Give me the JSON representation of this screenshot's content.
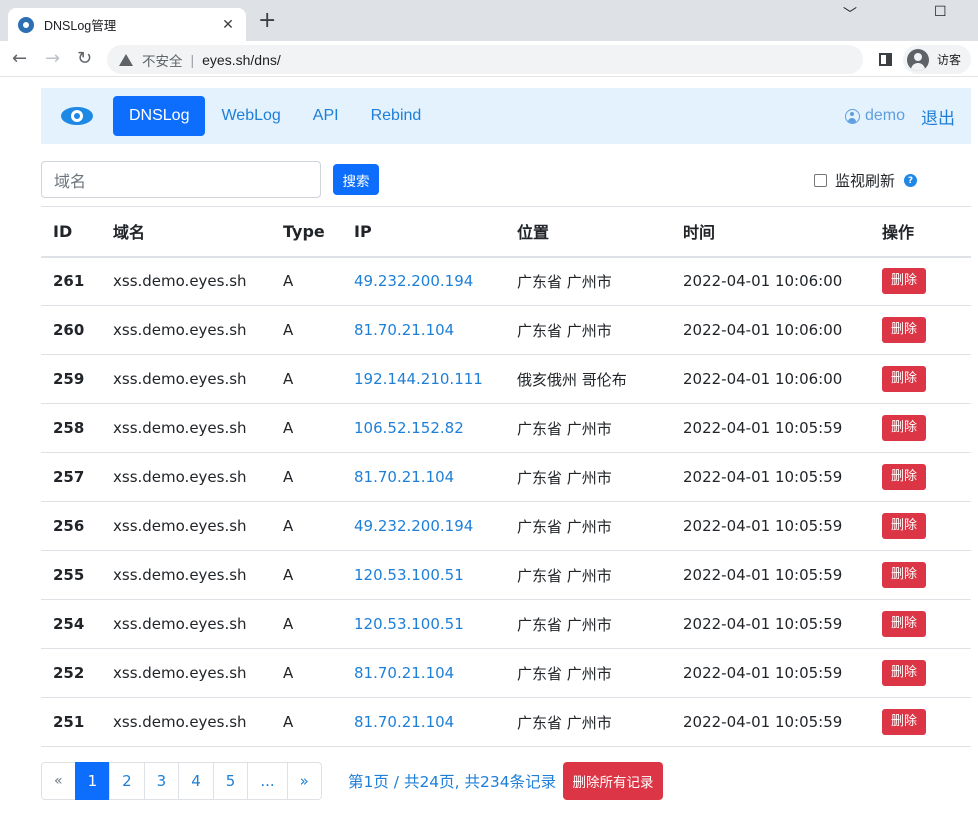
{
  "browser": {
    "tab_title": "DNSLog管理",
    "tab_close": "✕",
    "new_tab": "+",
    "insecure_label": "不安全",
    "url": "eyes.sh/dns/",
    "profile_label": "访客",
    "minimize": "﹀",
    "maximize": "☐",
    "restore": "—"
  },
  "navbar": {
    "links": [
      {
        "label": "DNSLog",
        "active": true
      },
      {
        "label": "WebLog",
        "active": false
      },
      {
        "label": "API",
        "active": false
      },
      {
        "label": "Rebind",
        "active": false
      }
    ],
    "user": "demo",
    "logout": "退出"
  },
  "search": {
    "placeholder": "域名",
    "button": "搜索",
    "monitor_label": "监视刷新",
    "help": "?"
  },
  "table": {
    "headers": [
      "ID",
      "域名",
      "Type",
      "IP",
      "位置",
      "时间",
      "操作"
    ],
    "rows": [
      {
        "id": "261",
        "domain": "xss.demo.eyes.sh",
        "type": "A",
        "ip": "49.232.200.194",
        "location": "广东省 广州市",
        "time": "2022-04-01 10:06:00",
        "action": "删除"
      },
      {
        "id": "260",
        "domain": "xss.demo.eyes.sh",
        "type": "A",
        "ip": "81.70.21.104",
        "location": "广东省 广州市",
        "time": "2022-04-01 10:06:00",
        "action": "删除"
      },
      {
        "id": "259",
        "domain": "xss.demo.eyes.sh",
        "type": "A",
        "ip": "192.144.210.111",
        "location": "俄亥俄州 哥伦布",
        "time": "2022-04-01 10:06:00",
        "action": "删除"
      },
      {
        "id": "258",
        "domain": "xss.demo.eyes.sh",
        "type": "A",
        "ip": "106.52.152.82",
        "location": "广东省 广州市",
        "time": "2022-04-01 10:05:59",
        "action": "删除"
      },
      {
        "id": "257",
        "domain": "xss.demo.eyes.sh",
        "type": "A",
        "ip": "81.70.21.104",
        "location": "广东省 广州市",
        "time": "2022-04-01 10:05:59",
        "action": "删除"
      },
      {
        "id": "256",
        "domain": "xss.demo.eyes.sh",
        "type": "A",
        "ip": "49.232.200.194",
        "location": "广东省 广州市",
        "time": "2022-04-01 10:05:59",
        "action": "删除"
      },
      {
        "id": "255",
        "domain": "xss.demo.eyes.sh",
        "type": "A",
        "ip": "120.53.100.51",
        "location": "广东省 广州市",
        "time": "2022-04-01 10:05:59",
        "action": "删除"
      },
      {
        "id": "254",
        "domain": "xss.demo.eyes.sh",
        "type": "A",
        "ip": "120.53.100.51",
        "location": "广东省 广州市",
        "time": "2022-04-01 10:05:59",
        "action": "删除"
      },
      {
        "id": "252",
        "domain": "xss.demo.eyes.sh",
        "type": "A",
        "ip": "81.70.21.104",
        "location": "广东省 广州市",
        "time": "2022-04-01 10:05:59",
        "action": "删除"
      },
      {
        "id": "251",
        "domain": "xss.demo.eyes.sh",
        "type": "A",
        "ip": "81.70.21.104",
        "location": "广东省 广州市",
        "time": "2022-04-01 10:05:59",
        "action": "删除"
      }
    ]
  },
  "pagination": {
    "items": [
      "«",
      "1",
      "2",
      "3",
      "4",
      "5",
      "...",
      "»"
    ],
    "active": "1",
    "info": "第1页 / 共24页, 共234条记录",
    "delete_all": "删除所有记录"
  }
}
